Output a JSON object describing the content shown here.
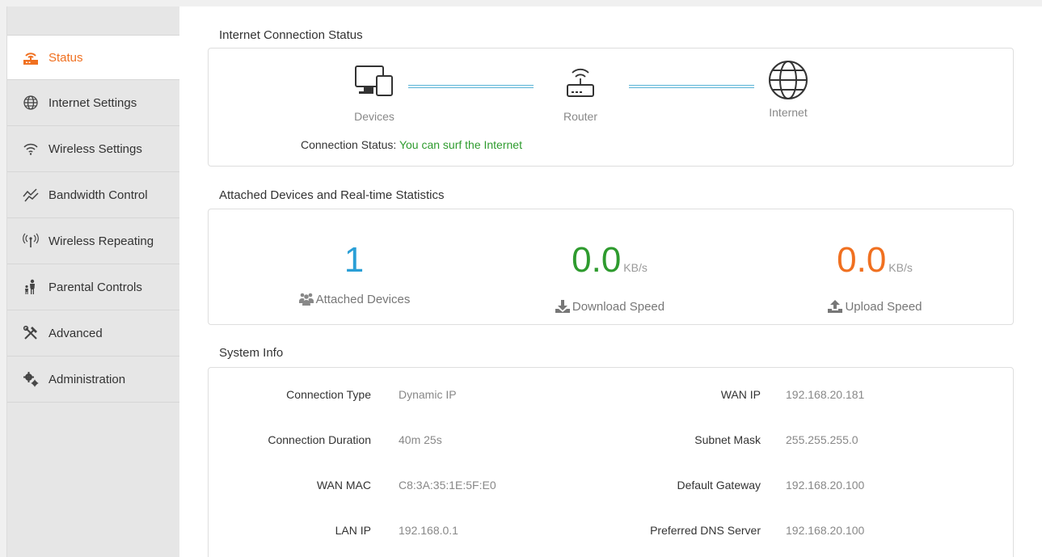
{
  "sidebar": {
    "items": [
      {
        "label": "Status",
        "icon": "router-icon",
        "active": true
      },
      {
        "label": "Internet Settings",
        "icon": "globe-icon"
      },
      {
        "label": "Wireless Settings",
        "icon": "wifi-icon"
      },
      {
        "label": "Bandwidth Control",
        "icon": "bandwidth-icon"
      },
      {
        "label": "Wireless Repeating",
        "icon": "repeater-icon"
      },
      {
        "label": "Parental Controls",
        "icon": "family-icon"
      },
      {
        "label": "Advanced",
        "icon": "tools-icon"
      },
      {
        "label": "Administration",
        "icon": "gears-icon"
      }
    ]
  },
  "connection": {
    "title": "Internet Connection Status",
    "devices_label": "Devices",
    "router_label": "Router",
    "internet_label": "Internet",
    "status_key": "Connection Status:",
    "status_value": "You can surf the Internet"
  },
  "stats": {
    "title": "Attached Devices and Real-time Statistics",
    "attached_value": "1",
    "attached_label": "Attached Devices",
    "download_value": "0.0",
    "download_unit": "KB/s",
    "download_label": "Download Speed",
    "upload_value": "0.0",
    "upload_unit": "KB/s",
    "upload_label": "Upload Speed"
  },
  "system": {
    "title": "System Info",
    "left": [
      {
        "key": "Connection Type",
        "value": "Dynamic IP"
      },
      {
        "key": "Connection Duration",
        "value": "40m 25s"
      },
      {
        "key": "WAN MAC",
        "value": "C8:3A:35:1E:5F:E0"
      },
      {
        "key": "LAN IP",
        "value": "192.168.0.1"
      }
    ],
    "right": [
      {
        "key": "WAN IP",
        "value": "192.168.20.181"
      },
      {
        "key": "Subnet Mask",
        "value": "255.255.255.0"
      },
      {
        "key": "Default Gateway",
        "value": "192.168.20.100"
      },
      {
        "key": "Preferred DNS Server",
        "value": "192.168.20.100"
      }
    ]
  },
  "colors": {
    "accent": "#f07020",
    "attached": "#2a9fd6",
    "download": "#2e9b2e",
    "upload": "#f07020",
    "line": "#5ab4d6"
  }
}
